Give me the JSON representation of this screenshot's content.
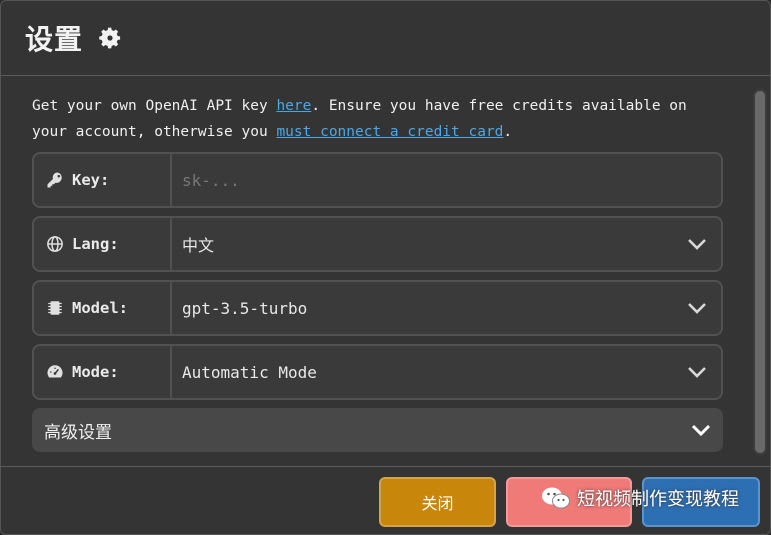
{
  "header": {
    "title": "设置",
    "icon": "gear-icon"
  },
  "intro": {
    "text_before_link1": "Get your own OpenAI API key ",
    "link1": "here",
    "text_after_link1": ". Ensure you have free credits available on your account, otherwise you ",
    "link2": "must connect a credit card",
    "text_end": "."
  },
  "fields": {
    "key": {
      "label": "Key:",
      "value": "",
      "placeholder": "sk-...",
      "icon": "key-icon"
    },
    "lang": {
      "label": "Lang:",
      "value": "中文",
      "icon": "globe-icon"
    },
    "model": {
      "label": "Model:",
      "value": "gpt-3.5-turbo",
      "icon": "chip-icon"
    },
    "mode": {
      "label": "Mode:",
      "value": "Automatic Mode",
      "icon": "gauge-icon"
    }
  },
  "advanced": {
    "label": "高级设置"
  },
  "footer": {
    "close_label": "关闭",
    "reset_label": "",
    "save_label": ""
  },
  "watermark": {
    "text": "短视频制作变现教程"
  },
  "colors": {
    "accent_link": "#4aa8e8",
    "close": "#c8860a",
    "reset": "#ef7a78",
    "save": "#2d6fb3",
    "panel": "#343434"
  }
}
